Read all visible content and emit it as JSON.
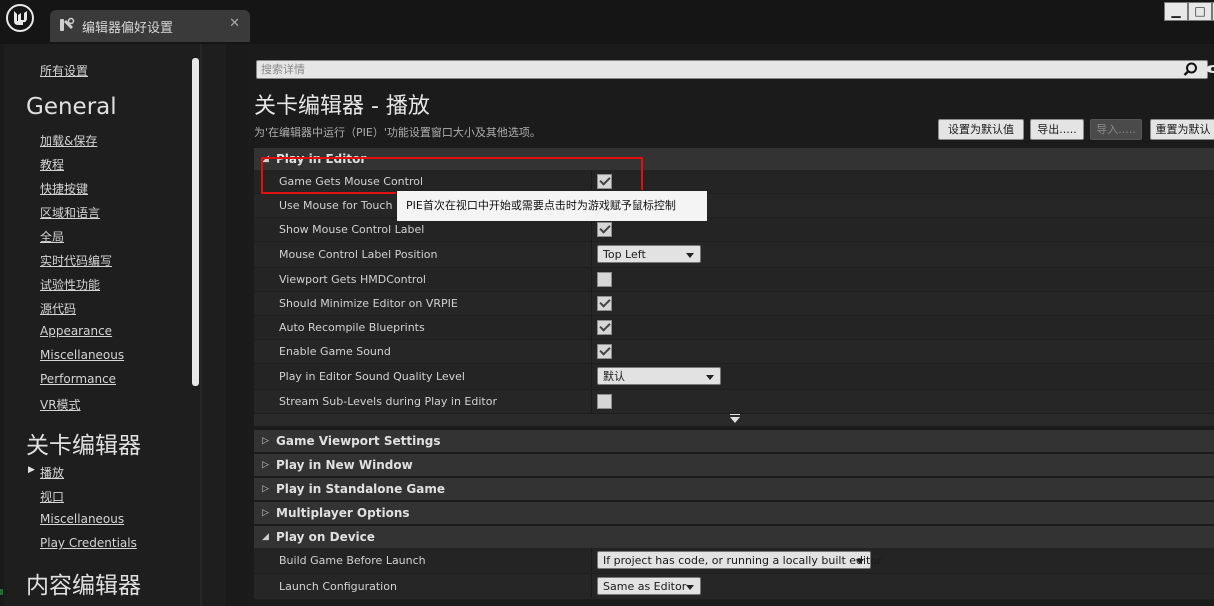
{
  "window": {
    "tab_title": "编辑器偏好设置",
    "close_glyph": "✕",
    "minimize_glyph": "▁",
    "maximize_glyph": "□",
    "window_close_glyph": "✕"
  },
  "sidebar": {
    "all_settings": "所有设置",
    "groups": [
      {
        "heading": "General",
        "items": [
          "加载&保存",
          "教程",
          "快捷按键",
          "区域和语言",
          "全局",
          "实时代码编写",
          "试验性功能",
          "源代码",
          "Appearance",
          "Miscellaneous",
          "Performance",
          "VR模式"
        ]
      },
      {
        "heading": "关卡编辑器",
        "items": [
          "播放",
          "视口",
          "Miscellaneous",
          "Play Credentials"
        ]
      },
      {
        "heading": "内容编辑器",
        "items": []
      }
    ]
  },
  "details": {
    "search_placeholder": "搜索详情",
    "title": "关卡编辑器 - 播放",
    "description": "为'在编辑器中运行（PIE）'功能设置窗口大小及其他选项。",
    "buttons": {
      "set_default": "设置为默认值",
      "export": "导出.....",
      "import": "导入.....",
      "reset_default": "重置为默认"
    },
    "sections": {
      "play_in_editor": "Play in Editor",
      "game_viewport": "Game Viewport Settings",
      "new_window": "Play in New Window",
      "standalone": "Play in Standalone Game",
      "multiplayer": "Multiplayer Options",
      "on_device": "Play on Device"
    },
    "pie_rows": [
      {
        "label": "Game Gets Mouse Control",
        "type": "checkbox",
        "checked": true
      },
      {
        "label": "Use Mouse for Touch",
        "type": "checkbox",
        "checked": false
      },
      {
        "label": "Show Mouse Control Label",
        "type": "checkbox",
        "checked": true
      },
      {
        "label": "Mouse Control Label Position",
        "type": "combo",
        "value": "Top Left"
      },
      {
        "label": "Viewport Gets HMDControl",
        "type": "checkbox",
        "checked": false
      },
      {
        "label": "Should Minimize Editor on VRPIE",
        "type": "checkbox",
        "checked": true
      },
      {
        "label": "Auto Recompile Blueprints",
        "type": "checkbox",
        "checked": true
      },
      {
        "label": "Enable Game Sound",
        "type": "checkbox",
        "checked": true
      },
      {
        "label": "Play in Editor Sound Quality Level",
        "type": "combo",
        "value": "默认"
      },
      {
        "label": "Stream Sub-Levels during Play in Editor",
        "type": "checkbox",
        "checked": false
      }
    ],
    "device_rows": [
      {
        "label": "Build Game Before Launch",
        "type": "combo",
        "value": "If project has code, or running a locally built editor"
      },
      {
        "label": "Launch Configuration",
        "type": "combo",
        "value": "Same as Editor"
      }
    ],
    "tooltip": "PIE首次在视口中开始或需要点击时为游戏赋予鼠标控制"
  }
}
